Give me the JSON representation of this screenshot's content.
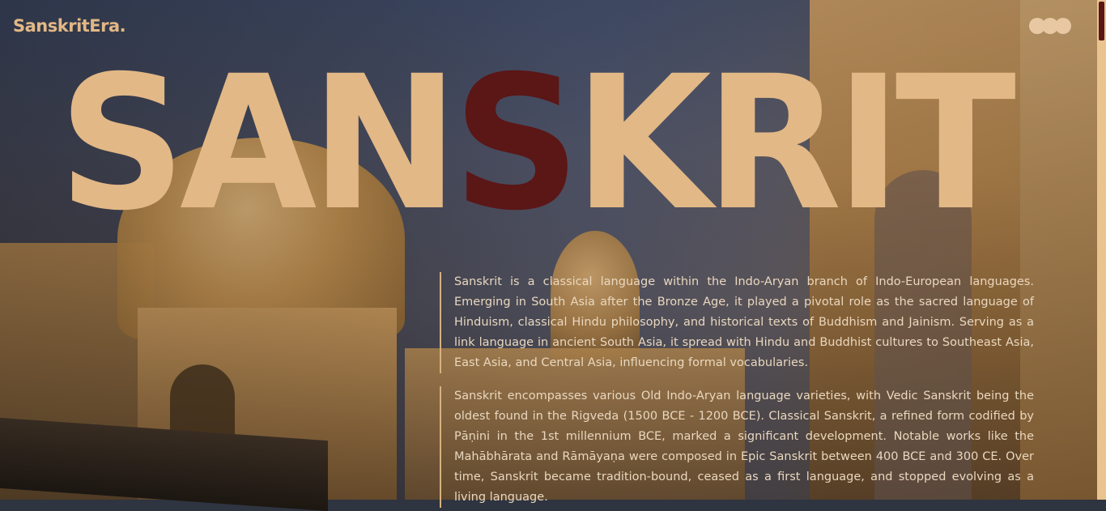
{
  "header": {
    "logo": "SanskritEra."
  },
  "hero": {
    "title_before": "SAN",
    "title_accent": "S",
    "title_after": "KRIT"
  },
  "content": {
    "paragraphs": [
      "Sanskrit is a classical language within the Indo-Aryan branch of Indo-European languages. Emerging in South Asia after the Bronze Age, it played a pivotal role as the sacred language of Hinduism, classical Hindu philosophy, and historical texts of Buddhism and Jainism. Serving as a link language in ancient South Asia, it spread with Hindu and Buddhist cultures to Southeast Asia, East Asia, and Central Asia, influencing formal vocabularies.",
      "Sanskrit encompasses various Old Indo-Aryan language varieties, with Vedic Sanskrit being the oldest found in the Rigveda (1500 BCE - 1200 BCE). Classical Sanskrit, a refined form codified by Pāṇini in the 1st millennium BCE, marked a significant development. Notable works like the Mahābhārata and Rāmāyaṇa were composed in Epic Sanskrit between 400 BCE and 300 CE. Over time, Sanskrit became tradition-bound, ceased as a first language, and stopped evolving as a living language."
    ]
  },
  "icons": {
    "menu": "three-dots-menu-icon"
  },
  "colors": {
    "accent": "#e2b886",
    "highlight": "#5b1616",
    "text": "#ead8bf"
  }
}
